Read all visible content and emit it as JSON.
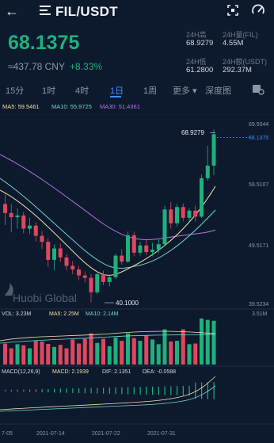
{
  "header": {
    "title": "FIL/USDT"
  },
  "ticker": {
    "price": "68.1375",
    "cny": "≈437.78 CNY",
    "change": "+8.33%",
    "stats": [
      {
        "label": "24H高",
        "value": "68.9279"
      },
      {
        "label": "24H量(FIL)",
        "value": "4.55M"
      },
      {
        "label": "24H低",
        "value": "61.2800"
      },
      {
        "label": "24H额(USDT)",
        "value": "292.37M"
      }
    ]
  },
  "tabs": [
    "15分",
    "1时",
    "4时",
    "1日",
    "1周",
    "更多 ▾",
    "深度图"
  ],
  "active_tab": "1日",
  "chart": {
    "ma_labels": {
      "ma5": "MA5: 59.5461",
      "ma10": "MA10: 55.9725",
      "ma30": "MA30: 51.4361"
    },
    "price_axis": [
      "69.5044",
      "59.5107",
      "49.5171",
      "39.5234"
    ],
    "last_price_tag": "68.1375",
    "high_label": "68.9279",
    "low_label": "40.1000",
    "watermark": "Huobi Global",
    "vol_labels": {
      "vol": "VOL: 3.23M",
      "ma5": "MA5: 2.25M",
      "ma10": "MA10: 2.14M",
      "max": "3.51M"
    },
    "macd_labels": {
      "name": "MACD(12,26,9)",
      "macd": "MACD: 2.1939",
      "dif": "DIF: 2.1351",
      "dea": "DEA: -0.0588"
    },
    "dates": [
      "7-05",
      "2021-07-14",
      "2021-07-22",
      "2021-07-31"
    ]
  },
  "colors": {
    "up": "#1fb07d",
    "down": "#e0475e",
    "ma5": "#f2dfa6",
    "ma10": "#6fd6c8",
    "ma30": "#b277e0",
    "accent": "#3f8cff"
  },
  "chart_data": {
    "type": "candlestick",
    "candles": [
      {
        "o": 56.5,
        "h": 58.2,
        "l": 53.0,
        "c": 55.0
      },
      {
        "o": 55.0,
        "h": 56.5,
        "l": 51.8,
        "c": 54.3
      },
      {
        "o": 54.3,
        "h": 55.8,
        "l": 52.4,
        "c": 54.6
      },
      {
        "o": 54.6,
        "h": 55.2,
        "l": 51.6,
        "c": 52.4
      },
      {
        "o": 52.4,
        "h": 54.2,
        "l": 51.5,
        "c": 52.9
      },
      {
        "o": 52.9,
        "h": 53.5,
        "l": 50.3,
        "c": 51.2
      },
      {
        "o": 51.2,
        "h": 52.0,
        "l": 49.0,
        "c": 50.2
      },
      {
        "o": 50.2,
        "h": 50.8,
        "l": 46.0,
        "c": 47.2
      },
      {
        "o": 47.2,
        "h": 49.8,
        "l": 45.5,
        "c": 49.1
      },
      {
        "o": 49.1,
        "h": 49.9,
        "l": 46.8,
        "c": 47.6
      },
      {
        "o": 47.6,
        "h": 48.2,
        "l": 45.4,
        "c": 46.2
      },
      {
        "o": 46.2,
        "h": 47.0,
        "l": 44.8,
        "c": 45.6
      },
      {
        "o": 45.6,
        "h": 46.2,
        "l": 43.8,
        "c": 44.6
      },
      {
        "o": 44.6,
        "h": 45.3,
        "l": 43.4,
        "c": 44.2
      },
      {
        "o": 44.2,
        "h": 44.8,
        "l": 40.1,
        "c": 41.8
      },
      {
        "o": 41.8,
        "h": 45.3,
        "l": 41.5,
        "c": 44.8
      },
      {
        "o": 44.8,
        "h": 45.4,
        "l": 43.0,
        "c": 43.5
      },
      {
        "o": 43.5,
        "h": 44.6,
        "l": 42.8,
        "c": 44.3
      },
      {
        "o": 44.3,
        "h": 48.2,
        "l": 44.0,
        "c": 47.9
      },
      {
        "o": 47.9,
        "h": 49.0,
        "l": 46.4,
        "c": 46.9
      },
      {
        "o": 46.9,
        "h": 51.9,
        "l": 46.7,
        "c": 51.3
      },
      {
        "o": 51.3,
        "h": 51.9,
        "l": 47.8,
        "c": 48.4
      },
      {
        "o": 48.4,
        "h": 50.2,
        "l": 47.9,
        "c": 49.6
      },
      {
        "o": 49.6,
        "h": 50.5,
        "l": 48.0,
        "c": 48.5
      },
      {
        "o": 48.5,
        "h": 50.0,
        "l": 47.8,
        "c": 48.9
      },
      {
        "o": 48.9,
        "h": 50.6,
        "l": 48.3,
        "c": 49.8
      },
      {
        "o": 49.8,
        "h": 56.2,
        "l": 49.6,
        "c": 55.6
      },
      {
        "o": 55.6,
        "h": 56.8,
        "l": 52.4,
        "c": 53.3
      },
      {
        "o": 53.3,
        "h": 56.5,
        "l": 52.8,
        "c": 56.0
      },
      {
        "o": 56.0,
        "h": 56.6,
        "l": 53.6,
        "c": 54.2
      },
      {
        "o": 54.2,
        "h": 55.8,
        "l": 53.6,
        "c": 55.4
      },
      {
        "o": 55.4,
        "h": 56.2,
        "l": 53.6,
        "c": 54.4
      },
      {
        "o": 54.4,
        "h": 61.4,
        "l": 54.2,
        "c": 60.8
      },
      {
        "o": 60.8,
        "h": 66.2,
        "l": 60.4,
        "c": 62.9
      },
      {
        "o": 62.9,
        "h": 68.9279,
        "l": 61.3,
        "c": 68.1375
      }
    ],
    "volume": [
      1.55,
      1.2,
      1.5,
      1.42,
      1.2,
      1.75,
      1.7,
      1.52,
      1.3,
      1.45,
      1.2,
      1.85,
      1.55,
      1.9,
      2.3,
      1.6,
      1.9,
      1.35,
      2.0,
      1.75,
      2.3,
      1.95,
      1.75,
      2.15,
      1.85,
      1.5,
      2.6,
      1.7,
      1.75,
      2.6,
      1.5,
      1.55,
      3.4,
      3.3,
      3.23
    ],
    "ylim": [
      39.5234,
      69.5044
    ]
  }
}
